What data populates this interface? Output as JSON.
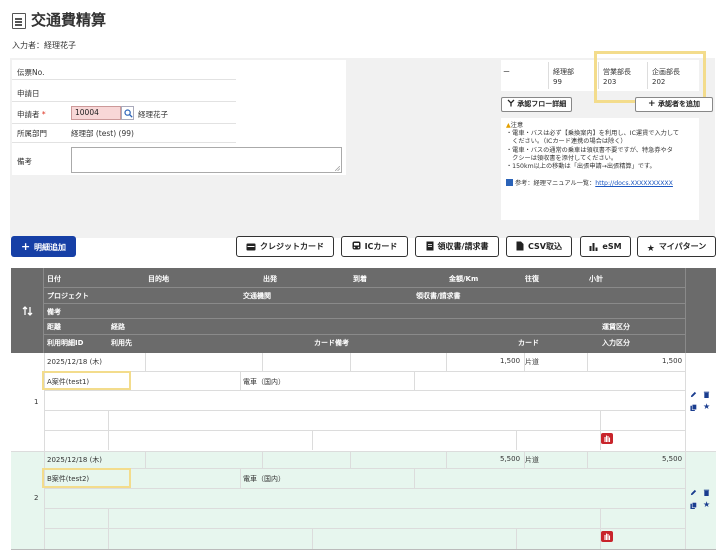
{
  "page": {
    "title": "交通費精算",
    "inputter": "入力者：経理花子"
  },
  "form": {
    "slip_no_label": "伝票No.",
    "apply_date_label": "申請日",
    "applicant_label": "申請者",
    "required_mark": "*",
    "applicant_code": "10004",
    "applicant_name": "経理花子",
    "dept_label": "所属部門",
    "dept_value": "経理部 (test) (99)",
    "notes_label": "備考"
  },
  "approval": {
    "cells": [
      {
        "title": "ー",
        "code": ""
      },
      {
        "title": "経理部",
        "code": "99"
      },
      {
        "title": "営業部長",
        "code": "203"
      },
      {
        "title": "企画部長",
        "code": "202"
      }
    ],
    "flow_button": "承認フロー詳細",
    "add_approver_button": "承認者を追加"
  },
  "notice": {
    "heading": "注意",
    "lines": [
      "・電車・バスは必ず【乗換案内】を利用し、IC運賃で入力して",
      "　ください。（ICカード連携の場合は除く）",
      "・電車・バスの通常の乗車は領収書不要ですが、特急券やタ",
      "　クシーは領収書を添付してください。",
      "・150km以上の移動は「出張申請→出張精算」です。"
    ],
    "ref_label": "参考：経理マニュアル一覧：",
    "ref_link": "http://docs.XXXXXXXXXX"
  },
  "toolbar": {
    "add_detail": "明細追加",
    "credit_card": "クレジットカード",
    "ic_card": "ICカード",
    "receipt": "領収書/請求書",
    "csv": "CSV取込",
    "esm": "eSM",
    "my_pattern": "マイパターン"
  },
  "table": {
    "headers": {
      "date": "日付",
      "destination": "目的地",
      "departure": "出発",
      "arrival": "到着",
      "amount_km": "金額/Km",
      "round_trip": "往復",
      "subtotal": "小計",
      "project": "プロジェクト",
      "transport": "交通機関",
      "receipt": "領収書/請求書",
      "notes": "備考",
      "distance": "距離",
      "route": "経路",
      "fare_type": "運賃区分",
      "usage_detail_id": "利用明細ID",
      "usage_place": "利用先",
      "card_notes": "カード備考",
      "card": "カード",
      "input_type": "入力区分"
    },
    "rows": [
      {
        "no": "1",
        "date": "2025/12/18 (木)",
        "amount": "1,500",
        "trip": "片道",
        "subtotal": "1,500",
        "project": "A案件(test1)",
        "transport": "電車（国内）"
      },
      {
        "no": "2",
        "date": "2025/12/18 (木)",
        "amount": "5,500",
        "trip": "片道",
        "subtotal": "5,500",
        "project": "B案件(test2)",
        "transport": "電車（国内）"
      }
    ]
  },
  "colors": {
    "primary": "#163fa6",
    "header_bg": "#6b6b6b",
    "highlight": "#f3dc8c",
    "row2_bg": "#e7f6ee",
    "required": "#dd3322"
  }
}
